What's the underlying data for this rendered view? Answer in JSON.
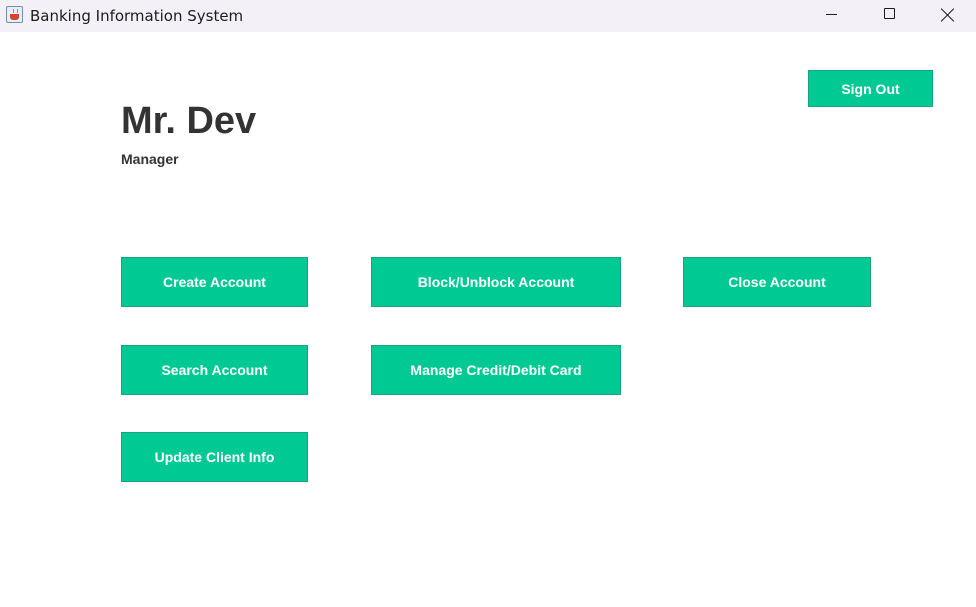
{
  "window": {
    "title": "Banking Information System",
    "icon": "java-cup-icon"
  },
  "header": {
    "user_name": "Mr. Dev",
    "user_role": "Manager",
    "sign_out_label": "Sign Out"
  },
  "actions": {
    "create_account": "Create Account",
    "block_unblock_account": "Block/Unblock Account",
    "close_account": "Close Account",
    "search_account": "Search Account",
    "manage_card": "Manage Credit/Debit Card",
    "update_client_info": "Update Client Info"
  },
  "colors": {
    "button_bg": "#00c994",
    "button_text": "#ffffff",
    "heading_text": "#333333",
    "titlebar_bg": "#f3f1f7"
  }
}
